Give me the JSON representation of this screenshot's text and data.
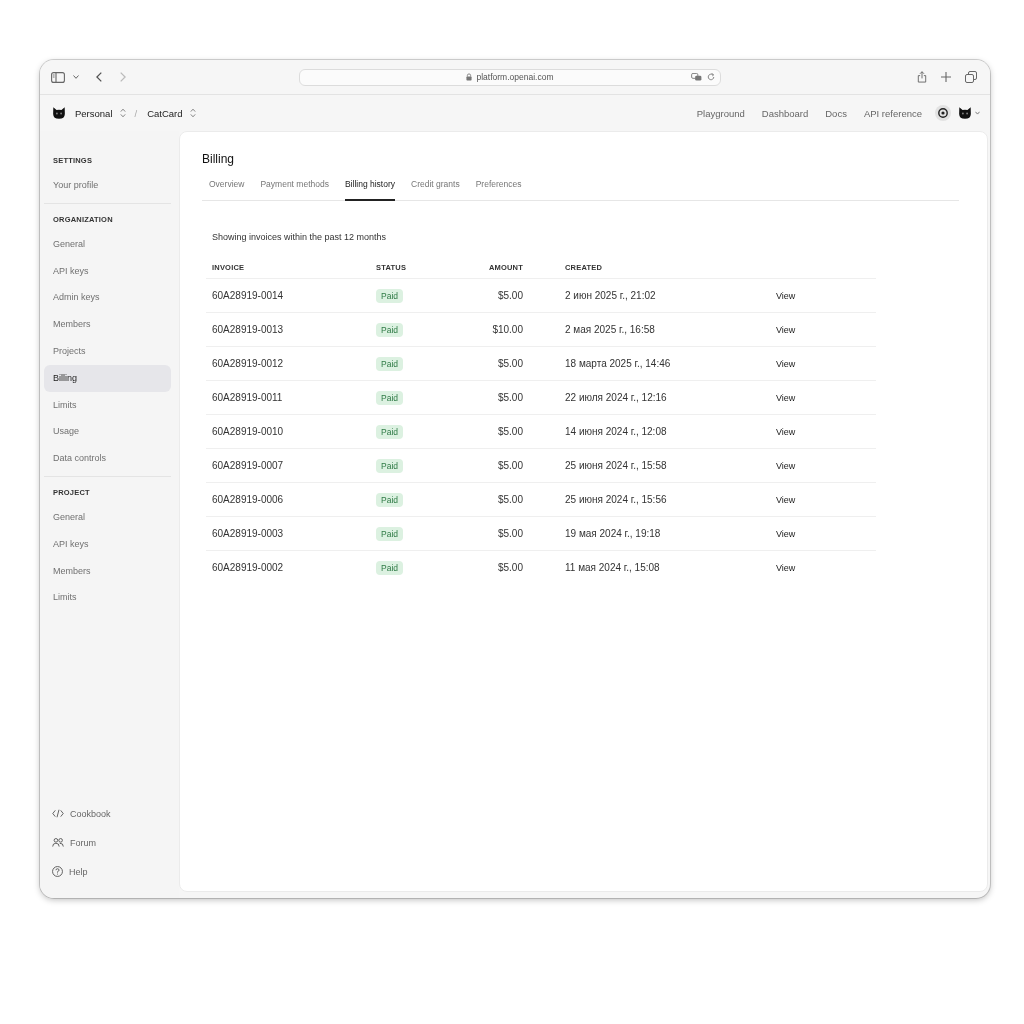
{
  "browser": {
    "address": "platform.openai.com"
  },
  "header": {
    "breadcrumbs": [
      "Personal",
      "CatCard"
    ],
    "separator": "/",
    "nav": [
      "Playground",
      "Dashboard",
      "Docs",
      "API reference"
    ]
  },
  "sidebar": {
    "sections": [
      {
        "heading": "SETTINGS",
        "items": [
          {
            "label": "Your profile",
            "selected": false
          }
        ]
      },
      {
        "heading": "ORGANIZATION",
        "items": [
          {
            "label": "General",
            "selected": false
          },
          {
            "label": "API keys",
            "selected": false
          },
          {
            "label": "Admin keys",
            "selected": false
          },
          {
            "label": "Members",
            "selected": false
          },
          {
            "label": "Projects",
            "selected": false
          },
          {
            "label": "Billing",
            "selected": true
          },
          {
            "label": "Limits",
            "selected": false
          },
          {
            "label": "Usage",
            "selected": false
          },
          {
            "label": "Data controls",
            "selected": false
          }
        ]
      },
      {
        "heading": "PROJECT",
        "items": [
          {
            "label": "General",
            "selected": false
          },
          {
            "label": "API keys",
            "selected": false
          },
          {
            "label": "Members",
            "selected": false
          },
          {
            "label": "Limits",
            "selected": false
          }
        ]
      }
    ],
    "footer": [
      {
        "label": "Cookbook",
        "kind": "code"
      },
      {
        "label": "Forum",
        "kind": "people"
      },
      {
        "label": "Help",
        "kind": "help"
      }
    ]
  },
  "page": {
    "title": "Billing",
    "tabs": [
      {
        "label": "Overview",
        "selected": false
      },
      {
        "label": "Payment methods",
        "selected": false
      },
      {
        "label": "Billing history",
        "selected": true
      },
      {
        "label": "Credit grants",
        "selected": false
      },
      {
        "label": "Preferences",
        "selected": false
      }
    ],
    "note": "Showing invoices within the past 12 months",
    "table": {
      "columns": [
        "INVOICE",
        "STATUS",
        "AMOUNT",
        "CREATED"
      ],
      "rows": [
        {
          "invoice": "60A28919-0014",
          "status": "Paid",
          "amount": "$5.00",
          "created": "2 июн 2025 г., 21:02",
          "action": "View"
        },
        {
          "invoice": "60A28919-0013",
          "status": "Paid",
          "amount": "$10.00",
          "created": "2 мая 2025 г., 16:58",
          "action": "View"
        },
        {
          "invoice": "60A28919-0012",
          "status": "Paid",
          "amount": "$5.00",
          "created": "18 марта 2025 г., 14:46",
          "action": "View"
        },
        {
          "invoice": "60A28919-0011",
          "status": "Paid",
          "amount": "$5.00",
          "created": "22 июля 2024 г., 12:16",
          "action": "View"
        },
        {
          "invoice": "60A28919-0010",
          "status": "Paid",
          "amount": "$5.00",
          "created": "14 июня 2024 г., 12:08",
          "action": "View"
        },
        {
          "invoice": "60A28919-0007",
          "status": "Paid",
          "amount": "$5.00",
          "created": "25 июня 2024 г., 15:58",
          "action": "View"
        },
        {
          "invoice": "60A28919-0006",
          "status": "Paid",
          "amount": "$5.00",
          "created": "25 июня 2024 г., 15:56",
          "action": "View"
        },
        {
          "invoice": "60A28919-0003",
          "status": "Paid",
          "amount": "$5.00",
          "created": "19 мая 2024 г., 19:18",
          "action": "View"
        },
        {
          "invoice": "60A28919-0002",
          "status": "Paid",
          "amount": "$5.00",
          "created": "11 мая 2024 г., 15:08",
          "action": "View"
        }
      ]
    }
  }
}
